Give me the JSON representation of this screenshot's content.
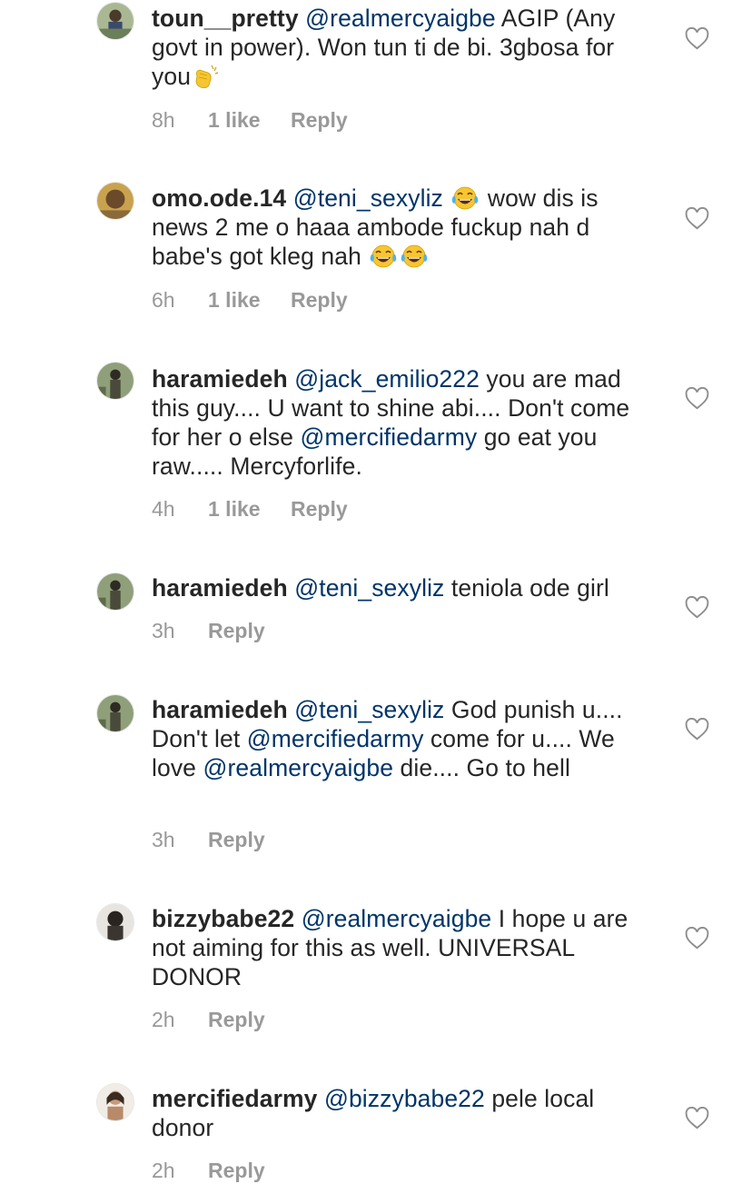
{
  "comments": [
    {
      "username": "toun__pretty",
      "segments": [
        {
          "type": "mention",
          "text": "@realmercyaigbe"
        },
        {
          "type": "text",
          "text": " AGIP (Any govt in power). Won tun ti de bi. 3gbosa for you"
        },
        {
          "type": "emoji",
          "name": "clapping-hands-emoji"
        }
      ],
      "time": "8h",
      "likes": "1 like",
      "reply": "Reply",
      "avatar_color": "#6b7f5a"
    },
    {
      "username": "omo.ode.14",
      "segments": [
        {
          "type": "mention",
          "text": "@teni_sexyliz"
        },
        {
          "type": "text",
          "text": " "
        },
        {
          "type": "emoji",
          "name": "tears-of-joy-emoji"
        },
        {
          "type": "text",
          "text": " wow dis is news 2 me o haaa ambode fuckup nah d babe's got kleg nah "
        },
        {
          "type": "emoji",
          "name": "tears-of-joy-emoji"
        },
        {
          "type": "emoji",
          "name": "tears-of-joy-emoji"
        }
      ],
      "time": "6h",
      "likes": "1 like",
      "reply": "Reply",
      "avatar_color": "#9a7a3e"
    },
    {
      "username": "haramiedeh",
      "segments": [
        {
          "type": "mention",
          "text": "@jack_emilio222"
        },
        {
          "type": "text",
          "text": " you are mad this guy.... U want to shine abi.... Don't come for her o else "
        },
        {
          "type": "mention",
          "text": "@mercifiedarmy"
        },
        {
          "type": "text",
          "text": " go eat you raw..... Mercyforlife."
        }
      ],
      "time": "4h",
      "likes": "1 like",
      "reply": "Reply",
      "avatar_color": "#5d6b4a"
    },
    {
      "username": "haramiedeh",
      "segments": [
        {
          "type": "mention",
          "text": "@teni_sexyliz"
        },
        {
          "type": "text",
          "text": " teniola ode girl"
        }
      ],
      "time": "3h",
      "likes": "",
      "reply": "Reply",
      "avatar_color": "#5d6b4a"
    },
    {
      "username": "haramiedeh",
      "segments": [
        {
          "type": "mention",
          "text": "@teni_sexyliz"
        },
        {
          "type": "text",
          "text": " God punish u.... Don't let "
        },
        {
          "type": "mention",
          "text": "@mercifiedarmy"
        },
        {
          "type": "text",
          "text": " come for u.... We love "
        },
        {
          "type": "mention",
          "text": "@realmercyaigbe"
        },
        {
          "type": "text",
          "text": " die.... Go to hell"
        }
      ],
      "time": "3h",
      "likes": "",
      "reply": "Reply",
      "avatar_color": "#5d6b4a"
    },
    {
      "username": "bizzybabe22",
      "segments": [
        {
          "type": "mention",
          "text": "@realmercyaigbe"
        },
        {
          "type": "text",
          "text": " I hope u are not aiming for this as well. UNIVERSAL DONOR"
        }
      ],
      "time": "2h",
      "likes": "",
      "reply": "Reply",
      "avatar_color": "#3a3530"
    },
    {
      "username": "mercifiedarmy",
      "segments": [
        {
          "type": "mention",
          "text": "@bizzybabe22"
        },
        {
          "type": "text",
          "text": " pele local donor"
        }
      ],
      "time": "2h",
      "likes": "",
      "reply": "Reply",
      "avatar_color": "#b88a6a"
    }
  ],
  "colors": {
    "username": "#262626",
    "mention": "#003569",
    "meta": "#999999",
    "heart": "#8e8e8e"
  }
}
